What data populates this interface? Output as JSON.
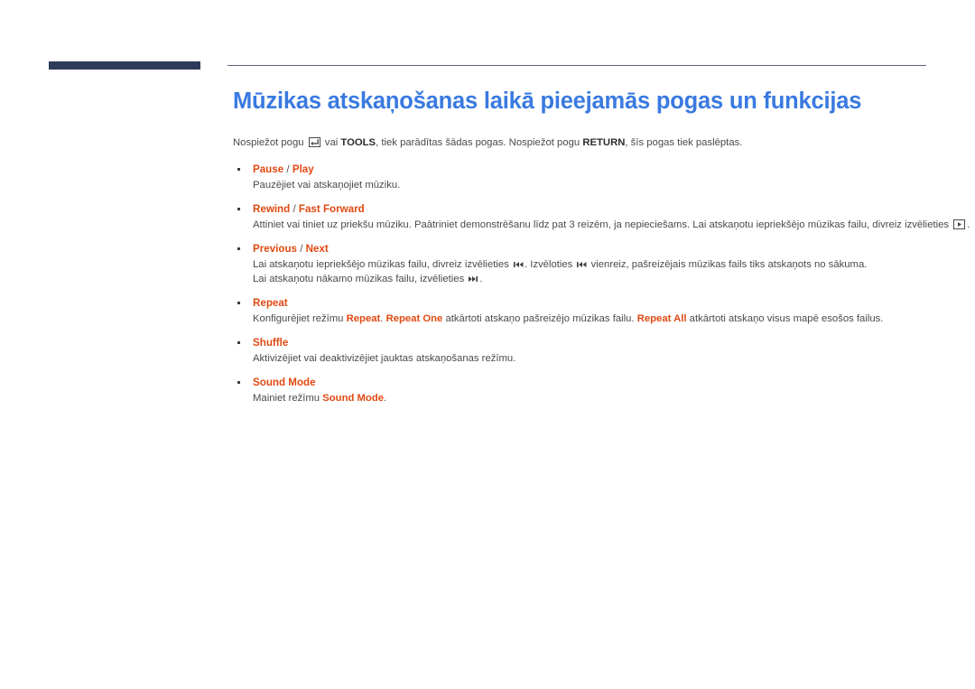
{
  "header": {
    "accent_bar_color": "#2e3a59",
    "rule_color": "#5b5f77"
  },
  "title": {
    "text": "Mūzikas atskaņošanas laikā pieejamās pogas un funkcijas",
    "color": "#3a7ae0"
  },
  "intro": {
    "part1": "Nospiežot pogu ",
    "enter_icon": "enter-key-icon",
    "part2": " vai ",
    "bold1": "TOOLS",
    "part3": ", tiek parādītas šādas pogas. Nospiežot pogu ",
    "bold2": "RETURN",
    "part4": ", šīs pogas tiek paslēptas."
  },
  "accent_color": "#e04912",
  "items": [
    {
      "name": "pause-play",
      "head_a": "Pause",
      "head_sep": " / ",
      "head_b": "Play",
      "body": "Pauzējiet vai atskaņojiet mūziku."
    },
    {
      "name": "rewind-fast-forward",
      "head_a": "Rewind",
      "head_sep": " / ",
      "head_b": "Fast Forward",
      "body_part1": "Attiniet vai tiniet uz priekšu mūziku. Paātriniet demonstrēšanu līdz pat 3 reizēm, ja nepieciešams. Lai atskaņotu iepriekšējo mūzikas failu, divreiz izvēlieties ",
      "play_icon": "play-button-icon",
      "body_part2": "."
    },
    {
      "name": "previous-next",
      "head_a": "Previous",
      "head_sep": " / ",
      "head_b": "Next",
      "line1_part1": "Lai atskaņotu iepriekšējo mūzikas failu, divreiz izvēlieties ",
      "line1_icon1": "skip-back-icon",
      "line1_part2": ". Izvēloties ",
      "line1_icon2": "skip-back-icon",
      "line1_part3": " vienreiz, pašreizējais mūzikas fails tiks atskaņots no sākuma.",
      "line2_part1": "Lai atskaņotu nākamo mūzikas failu, izvēlieties ",
      "line2_icon": "skip-forward-icon",
      "line2_part2": "."
    },
    {
      "name": "repeat",
      "head_a": "Repeat",
      "head_sep": "",
      "head_b": "",
      "body_part1": "Konfigurējiet režīmu ",
      "body_hl1": "Repeat",
      "body_part2": ". ",
      "body_hl2": "Repeat One",
      "body_part3": " atkārtoti atskaņo pašreizējo mūzikas failu. ",
      "body_hl3": "Repeat All",
      "body_part4": " atkārtoti atskaņo visus mapē esošos failus."
    },
    {
      "name": "shuffle",
      "head_a": "Shuffle",
      "head_sep": "",
      "head_b": "",
      "body": "Aktivizējiet vai deaktivizējiet jauktas atskaņošanas režīmu."
    },
    {
      "name": "sound-mode",
      "head_a": "Sound Mode",
      "head_sep": "",
      "head_b": "",
      "body_part1": "Mainiet režīmu ",
      "body_hl1": "Sound Mode",
      "body_part2": "."
    }
  ]
}
